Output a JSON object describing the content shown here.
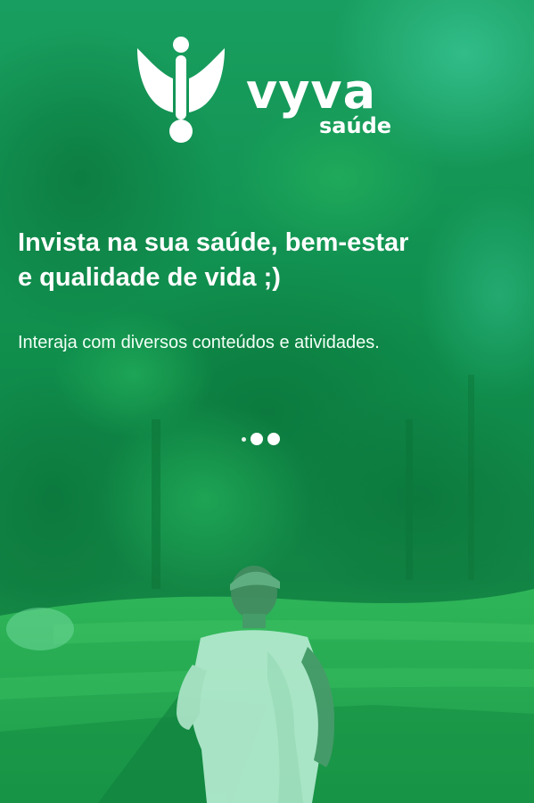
{
  "brand": {
    "name": "vyva",
    "sub": "saúde"
  },
  "onboarding": {
    "headline_line1": "Invista na sua saúde, bem-estar",
    "headline_line2": "e qualidade de vida ;)",
    "subtitle": "Interaja com diversos conteúdos e atividades.",
    "pager": {
      "total_pages": 3,
      "current_page": 1
    }
  },
  "theme": {
    "overlay_color": "#11a355",
    "text_color": "#ffffff"
  }
}
